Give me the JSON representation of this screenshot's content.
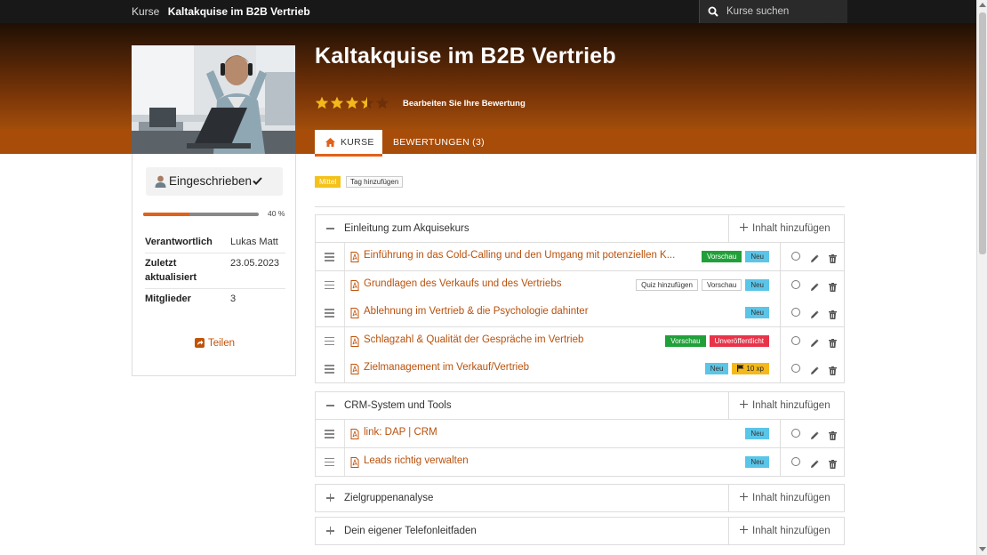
{
  "topbar": {
    "breadcrumb_root": "Kurse",
    "breadcrumb_current": "Kaltakquise im B2B Vertrieb",
    "search_placeholder": "Kurse suchen"
  },
  "course": {
    "title": "Kaltakquise im B2B Vertrieb",
    "rating": 3.5,
    "rating_max": 5,
    "rate_link": "Bearbeiten Sie Ihre Bewertung"
  },
  "tabs": [
    {
      "label": "KURSE",
      "icon": "home-icon",
      "active": true
    },
    {
      "label": "BEWERTUNGEN (3)",
      "active": false
    }
  ],
  "sidebar": {
    "enroll_label": "Eingeschrieben",
    "progress_percent": 40,
    "progress_label": "40 %",
    "meta": [
      {
        "key": "Verantwortlich",
        "value": "Lukas Matt"
      },
      {
        "key": "Zuletzt aktualisiert",
        "value": "23.05.2023"
      },
      {
        "key": "Mitglieder",
        "value": "3"
      }
    ],
    "share_label": "Teilen"
  },
  "tags": {
    "level": "Mittel",
    "add_tag": "Tag hinzufügen"
  },
  "colors": {
    "accent": "#e0611a",
    "link": "#b8510d",
    "badge_green": "#21a03a",
    "badge_blue": "#5bc5e8",
    "badge_red": "#e8344a",
    "badge_yellow": "#f4b81b"
  },
  "add_content_label": "Inhalt hinzufügen",
  "sections": [
    {
      "name": "Einleitung zum Akquisekurs",
      "expanded": true,
      "lessons": [
        {
          "name": "Einführung in das Cold-Calling und den Umgang mit potenziellen K...",
          "badges": [
            {
              "text": "Vorschau",
              "style": "green"
            },
            {
              "text": "Neu",
              "style": "blue"
            }
          ]
        },
        {
          "name": "Grundlagen des Verkaufs und des Vertriebs",
          "badges": [
            {
              "text": "Quiz hinzufügen",
              "style": "gray"
            },
            {
              "text": "Vorschau",
              "style": "gray"
            },
            {
              "text": "Neu",
              "style": "blue"
            }
          ]
        },
        {
          "name": "Ablehnung im Vertrieb & die Psychologie dahinter",
          "badges": [
            {
              "text": "Neu",
              "style": "blue"
            }
          ]
        },
        {
          "name": "Schlagzahl & Qualität der Gespräche im Vertrieb",
          "badges": [
            {
              "text": "Vorschau",
              "style": "green"
            },
            {
              "text": "Unveröffentlicht",
              "style": "red"
            }
          ]
        },
        {
          "name": "Zielmanagement im Verkauf/Vertrieb",
          "badges": [
            {
              "text": "Neu",
              "style": "blue"
            },
            {
              "text": "10 xp",
              "style": "yellow"
            }
          ]
        }
      ]
    },
    {
      "name": "CRM-System und Tools",
      "expanded": true,
      "lessons": [
        {
          "name": "link: DAP | CRM",
          "badges": [
            {
              "text": "Neu",
              "style": "blue"
            }
          ]
        },
        {
          "name": "Leads richtig verwalten",
          "badges": [
            {
              "text": "Neu",
              "style": "blue"
            }
          ]
        }
      ]
    },
    {
      "name": "Zielgruppenanalyse",
      "expanded": false,
      "lessons": []
    },
    {
      "name": "Dein eigener Telefonleitfaden",
      "expanded": false,
      "lessons": []
    }
  ]
}
